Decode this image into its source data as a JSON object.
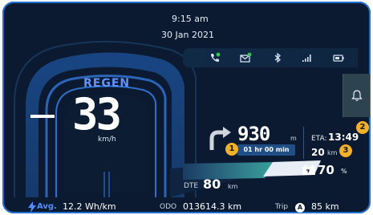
{
  "datetime": {
    "time": "9:15 am",
    "date": "30 Jan 2021"
  },
  "status_icons": [
    {
      "name": "phone-icon",
      "notification": true
    },
    {
      "name": "message-icon",
      "notification": true
    },
    {
      "name": "bluetooth-icon",
      "notification": false
    },
    {
      "name": "signal-icon",
      "notification": false
    },
    {
      "name": "battery-icon",
      "notification": false
    }
  ],
  "colors": {
    "background": "#0b1a30",
    "accent": "#1f6fd0",
    "regen": "#5f93ff",
    "notification_dot": "#39c45a",
    "badge": "#f2b12a",
    "battery_icon": "#f5a623"
  },
  "speedometer": {
    "mode": "REGEN",
    "speed": "33",
    "unit": "km/h"
  },
  "side_panel": {
    "icon": "bell-icon"
  },
  "navigation": {
    "distance": "930",
    "distance_unit": "m",
    "time_remaining": "01 hr 00 min",
    "badge_1": "1",
    "eta_label": "ETA:",
    "eta_value": "13:49",
    "badge_2": "2",
    "trip_distance": "20",
    "trip_distance_unit": "km",
    "badge_3": "3"
  },
  "battery": {
    "percent": "70",
    "unit": "%",
    "level": 0.7
  },
  "range": {
    "label": "DTE",
    "value": "80",
    "unit": "km"
  },
  "footer": {
    "avg_label": "Avg.",
    "avg_value": "12.2 Wh/km",
    "odo_label": "ODO",
    "odo_value": "013614.3 km",
    "trip_label": "Trip",
    "trip_mode": "A",
    "trip_value": "85 km"
  }
}
